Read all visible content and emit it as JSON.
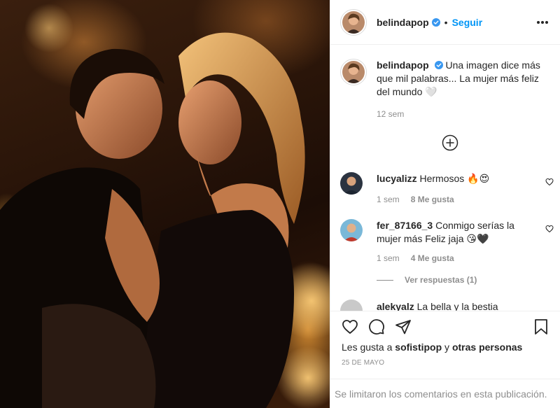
{
  "post": {
    "author": "belindapop",
    "follow_label": "Seguir",
    "dot": "•",
    "caption": {
      "username": "belindapop",
      "text": "Una imagen dice más que mil palabras... La mujer más feliz del mundo 🤍",
      "time": "12 sem"
    }
  },
  "comments": [
    {
      "username": "lucyalizz",
      "text": "Hermosos 🔥😍",
      "time": "1 sem",
      "likes": "8 Me gusta"
    },
    {
      "username": "fer_87166_3",
      "text": "Conmigo serías la mujer más Feliz jaja 😘🖤",
      "time": "1 sem",
      "likes": "4 Me gusta"
    }
  ],
  "view_replies": "Ver respuestas (1)",
  "next_comment": {
    "username": "alekyalz",
    "text": "La bella y la bestia"
  },
  "likes_summary": {
    "prefix": "Les gusta a ",
    "user": "sofistipop",
    "middle": " y ",
    "others": "otras personas"
  },
  "date": "25 DE MAYO",
  "comments_disabled": "Se limitaron los comentarios en esta publicación.",
  "colors": {
    "link": "#0095f6",
    "muted": "#8e8e8e",
    "text": "#262626",
    "divider": "#efefef"
  },
  "icons": [
    "verified-badge-icon",
    "more-options-icon",
    "load-more-icon",
    "heart-icon",
    "comment-icon",
    "share-icon",
    "bookmark-icon"
  ]
}
